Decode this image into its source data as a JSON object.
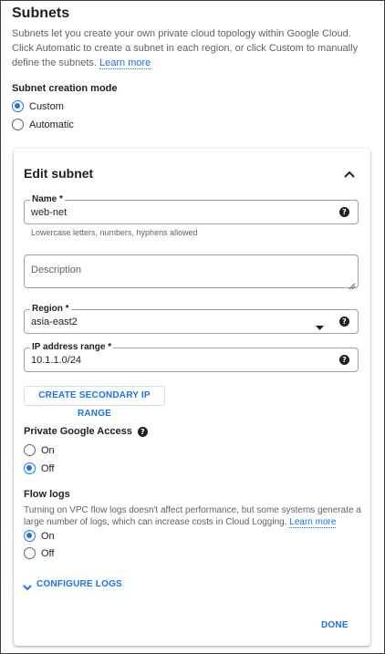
{
  "section": {
    "title": "Subnets",
    "description": "Subnets let you create your own private cloud topology within Google Cloud. Click Automatic to create a subnet in each region, or click Custom to manually define the subnets.",
    "learn_more": "Learn more"
  },
  "creation_mode": {
    "label": "Subnet creation mode",
    "options": [
      {
        "label": "Custom",
        "selected": true
      },
      {
        "label": "Automatic",
        "selected": false
      }
    ]
  },
  "edit_subnet": {
    "title": "Edit subnet",
    "name": {
      "label": "Name *",
      "value": "web-net",
      "hint": "Lowercase letters, numbers, hyphens allowed"
    },
    "description": {
      "placeholder": "Description",
      "value": ""
    },
    "region": {
      "label": "Region *",
      "value": "asia-east2"
    },
    "ip_range": {
      "label": "IP address range *",
      "value": "10.1.1.0/24"
    },
    "secondary_button": "CREATE SECONDARY IP RANGE",
    "private_access": {
      "label": "Private Google Access",
      "options": [
        {
          "label": "On",
          "selected": false
        },
        {
          "label": "Off",
          "selected": true
        }
      ]
    },
    "flow_logs": {
      "label": "Flow logs",
      "description": "Turning on VPC flow logs doesn't affect performance, but some systems generate a large number of logs, which can increase costs in Cloud Logging.",
      "learn_more": "Learn more",
      "options": [
        {
          "label": "On",
          "selected": true
        },
        {
          "label": "Off",
          "selected": false
        }
      ]
    },
    "configure_logs": "CONFIGURE LOGS",
    "done": "DONE"
  },
  "colors": {
    "accent": "#1a73e8",
    "text": "#202124",
    "muted": "#5f6368"
  },
  "icons": [
    "help-icon",
    "chevron-up-icon",
    "dropdown-arrow-icon",
    "chevron-down-icon",
    "resize-handle-icon"
  ]
}
